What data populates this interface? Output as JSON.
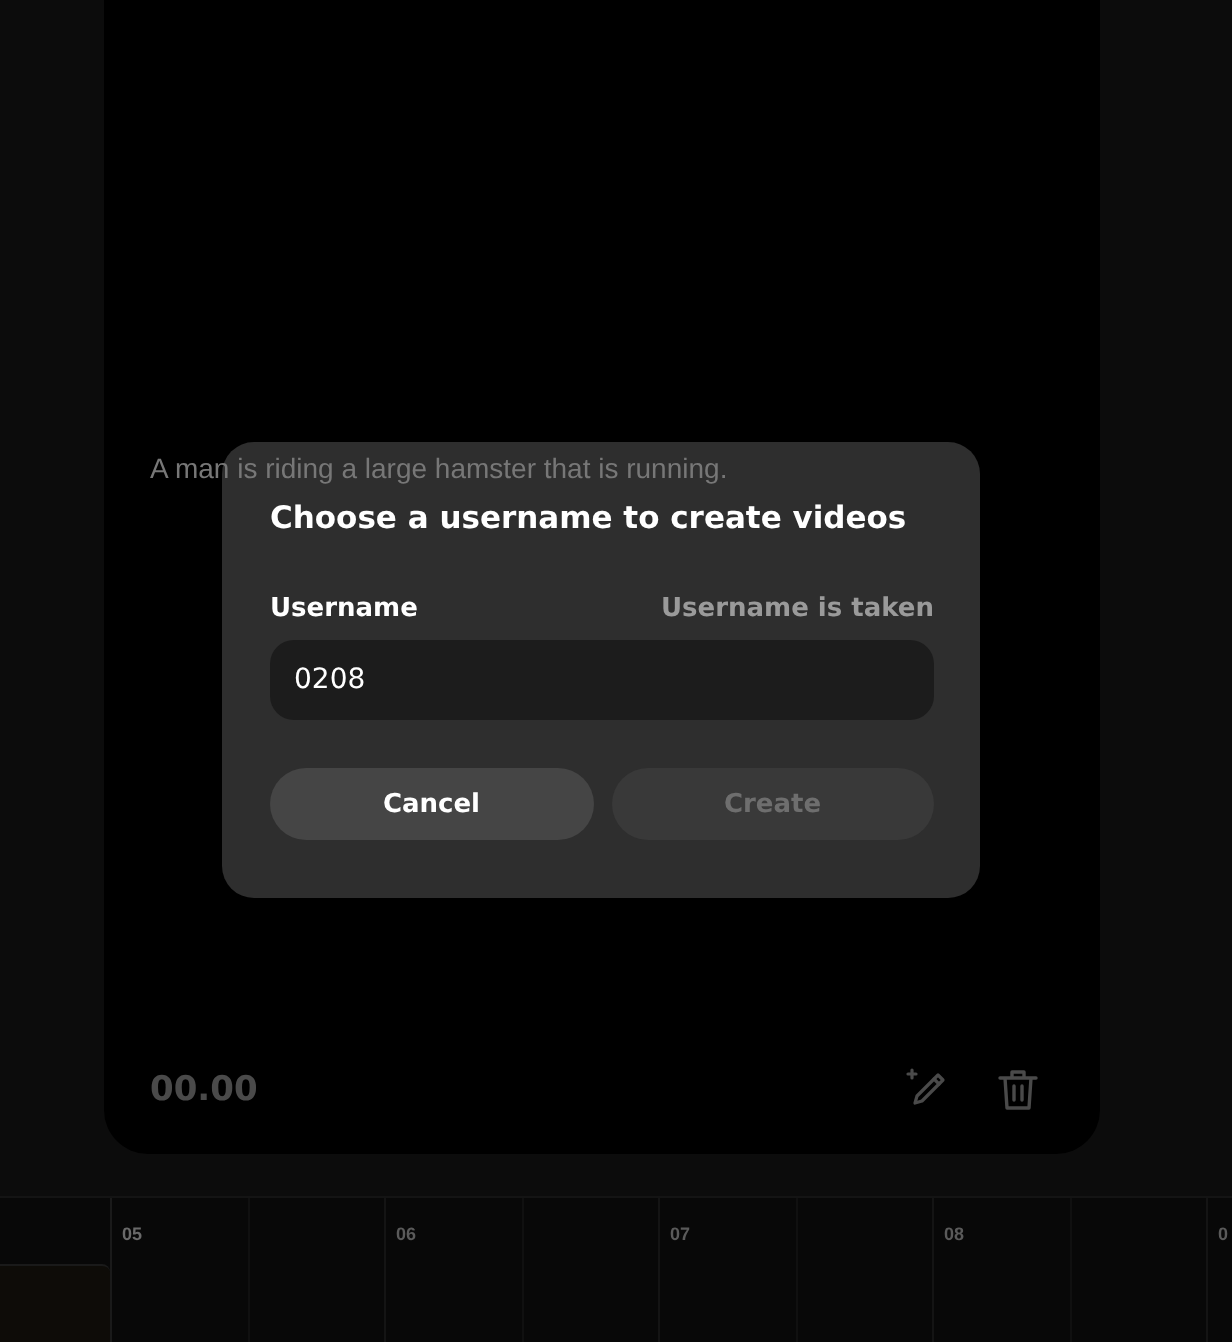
{
  "clip": {
    "caption": "A man is riding a large hamster that is running.",
    "duration": "00.00"
  },
  "dialog": {
    "title": "Choose a username to create videos",
    "field": {
      "label": "Username",
      "status": "Username is taken",
      "value": "0208"
    },
    "buttons": [
      {
        "label": "Cancel",
        "disabled": false
      },
      {
        "label": "Create",
        "disabled": true
      }
    ]
  },
  "timeline": {
    "ticks": [
      "05",
      "06",
      "07",
      "08",
      "0"
    ]
  }
}
